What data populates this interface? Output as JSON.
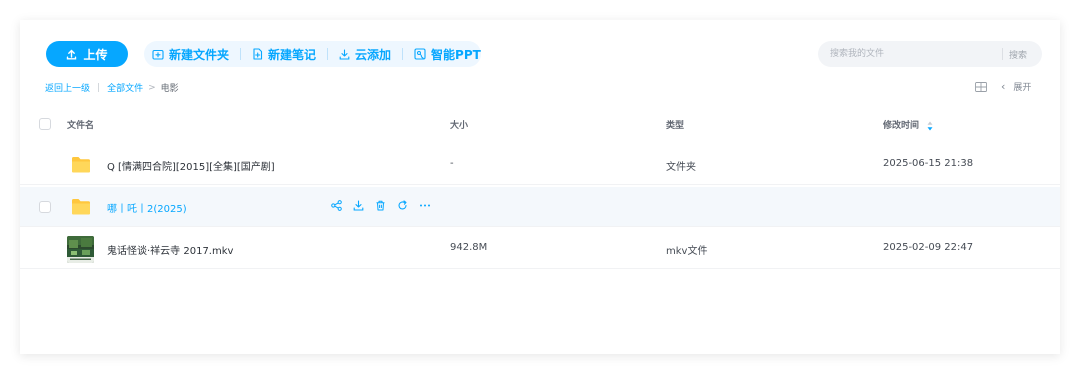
{
  "toolbar": {
    "upload_label": "上传",
    "new_folder_label": "新建文件夹",
    "new_note_label": "新建笔记",
    "cloud_add_label": "云添加",
    "smart_ppt_label": "智能PPT",
    "accent_color": "#06a7ff"
  },
  "search": {
    "placeholder": "搜索我的文件",
    "button_label": "搜索"
  },
  "breadcrumb": {
    "back_label": "返回上一级",
    "all_files_label": "全部文件",
    "separator": ">",
    "current_label": "电影"
  },
  "view": {
    "expand_label": "展开"
  },
  "table": {
    "columns": {
      "name": "文件名",
      "size": "大小",
      "type": "类型",
      "modified": "修改时间"
    },
    "rows": [
      {
        "icon": "folder-icon",
        "name": "Q [情满四合院][2015][全集][国产剧]",
        "size": "-",
        "type": "文件夹",
        "modified": "2025-06-15 21:38"
      },
      {
        "icon": "folder-icon",
        "name": "哪丨吒丨2(2025)",
        "size": "",
        "type": "",
        "modified": "",
        "actions": [
          "share-icon",
          "download-icon",
          "delete-icon",
          "refresh-icon",
          "more-icon"
        ]
      },
      {
        "icon": "video-thumbnail",
        "name": "鬼话怪谈·祥云寺 2017.mkv",
        "size": "942.8M",
        "type": "mkv文件",
        "modified": "2025-02-09 22:47"
      }
    ]
  }
}
